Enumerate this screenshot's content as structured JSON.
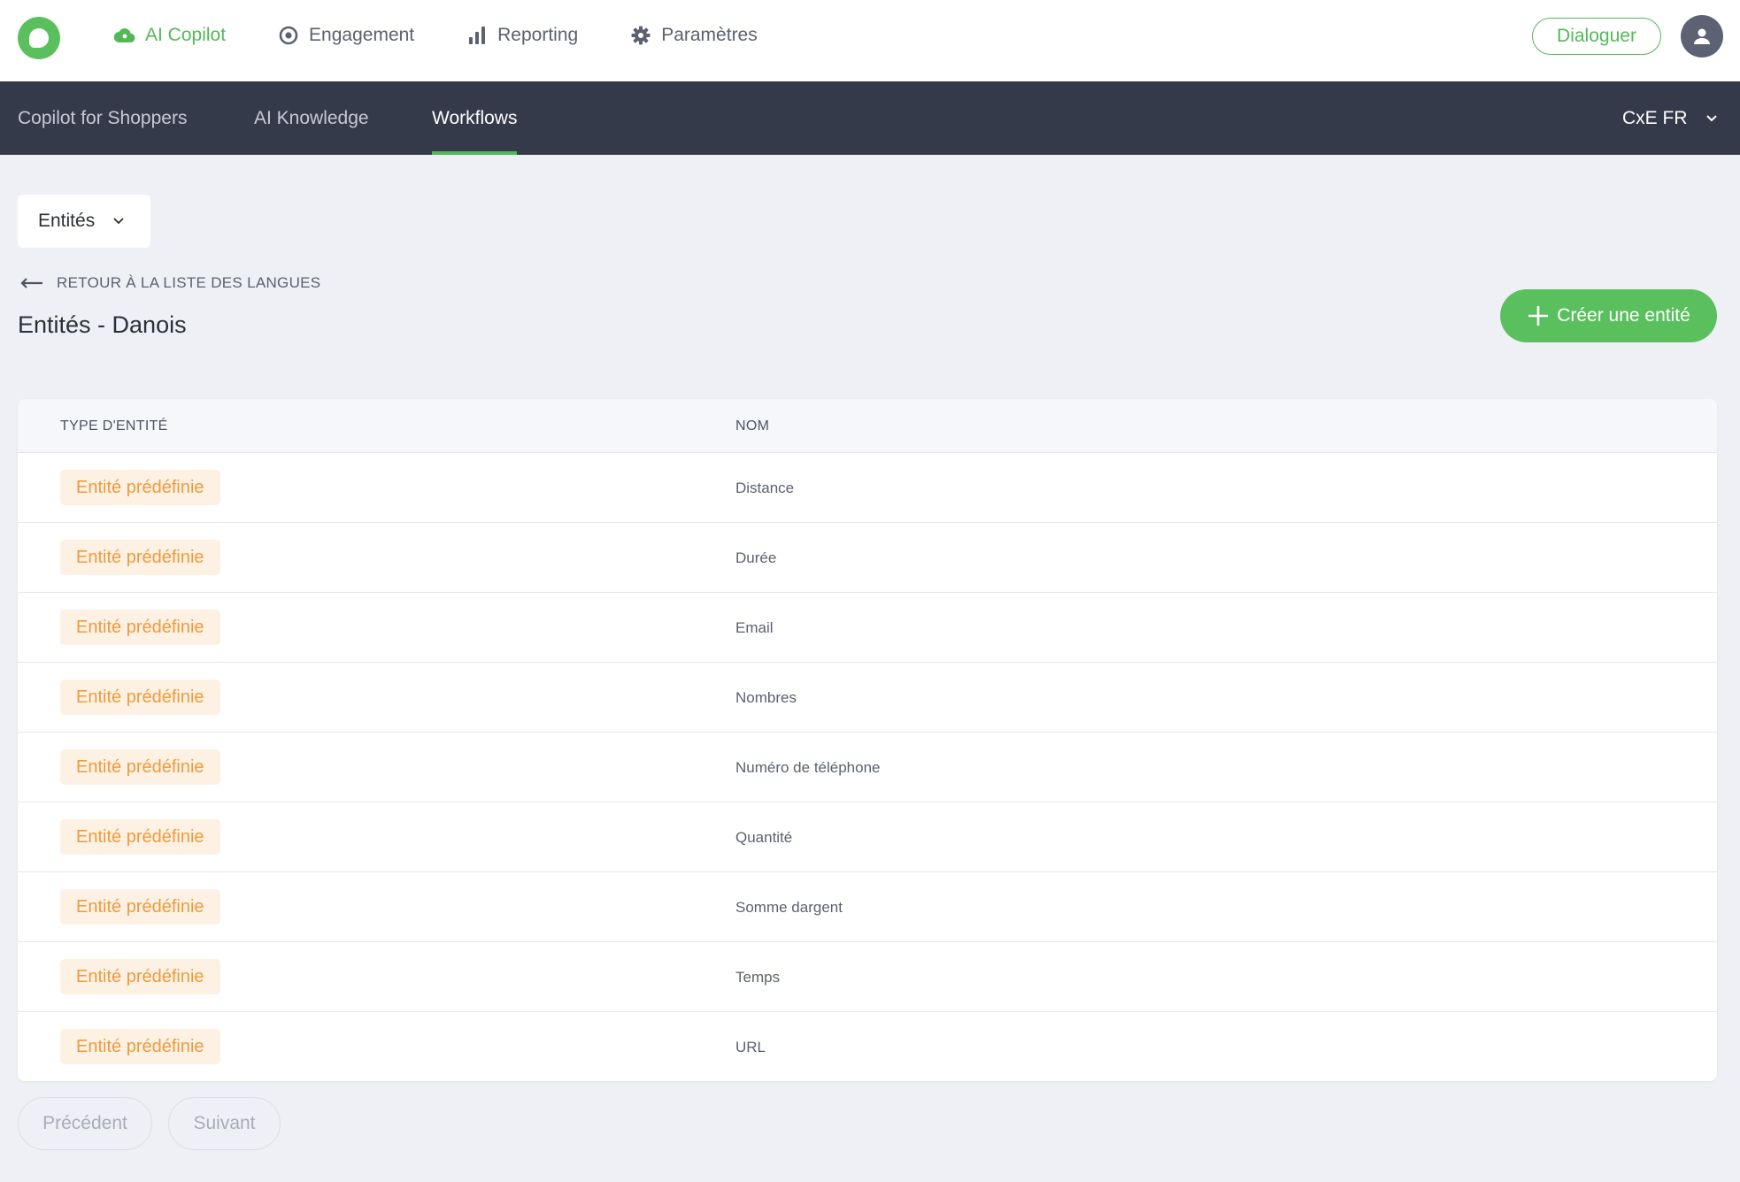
{
  "topnav": {
    "items": [
      {
        "label": "AI Copilot",
        "icon": "cloud-icon",
        "active": true
      },
      {
        "label": "Engagement",
        "icon": "target-icon",
        "active": false
      },
      {
        "label": "Reporting",
        "icon": "bar-chart-icon",
        "active": false
      },
      {
        "label": "Paramètres",
        "icon": "gear-icon",
        "active": false
      }
    ],
    "dialoguer_label": "Dialoguer"
  },
  "subnav": {
    "items": [
      {
        "label": "Copilot for Shoppers",
        "active": false
      },
      {
        "label": "AI Knowledge",
        "active": false
      },
      {
        "label": "Workflows",
        "active": true
      }
    ],
    "workspace": "CxE FR"
  },
  "content": {
    "dropdown_label": "Entités",
    "back_label": "RETOUR À LA LISTE DES LANGUES",
    "title": "Entités - Danois",
    "create_label": "Créer une entité"
  },
  "table": {
    "headers": [
      "TYPE D'ENTITÉ",
      "NOM"
    ],
    "rows": [
      {
        "type": "Entité prédéfinie",
        "name": "Distance"
      },
      {
        "type": "Entité prédéfinie",
        "name": "Durée"
      },
      {
        "type": "Entité prédéfinie",
        "name": "Email"
      },
      {
        "type": "Entité prédéfinie",
        "name": "Nombres"
      },
      {
        "type": "Entité prédéfinie",
        "name": "Numéro de téléphone"
      },
      {
        "type": "Entité prédéfinie",
        "name": "Quantité"
      },
      {
        "type": "Entité prédéfinie",
        "name": "Somme dargent"
      },
      {
        "type": "Entité prédéfinie",
        "name": "Temps"
      },
      {
        "type": "Entité prédéfinie",
        "name": "URL"
      }
    ]
  },
  "pagination": {
    "prev_label": "Précédent",
    "next_label": "Suivant"
  },
  "colors": {
    "accent": "#53b957",
    "subnav_bg": "#353a4a",
    "badge_bg": "#fdf1e3",
    "badge_text": "#ef9a3c"
  }
}
